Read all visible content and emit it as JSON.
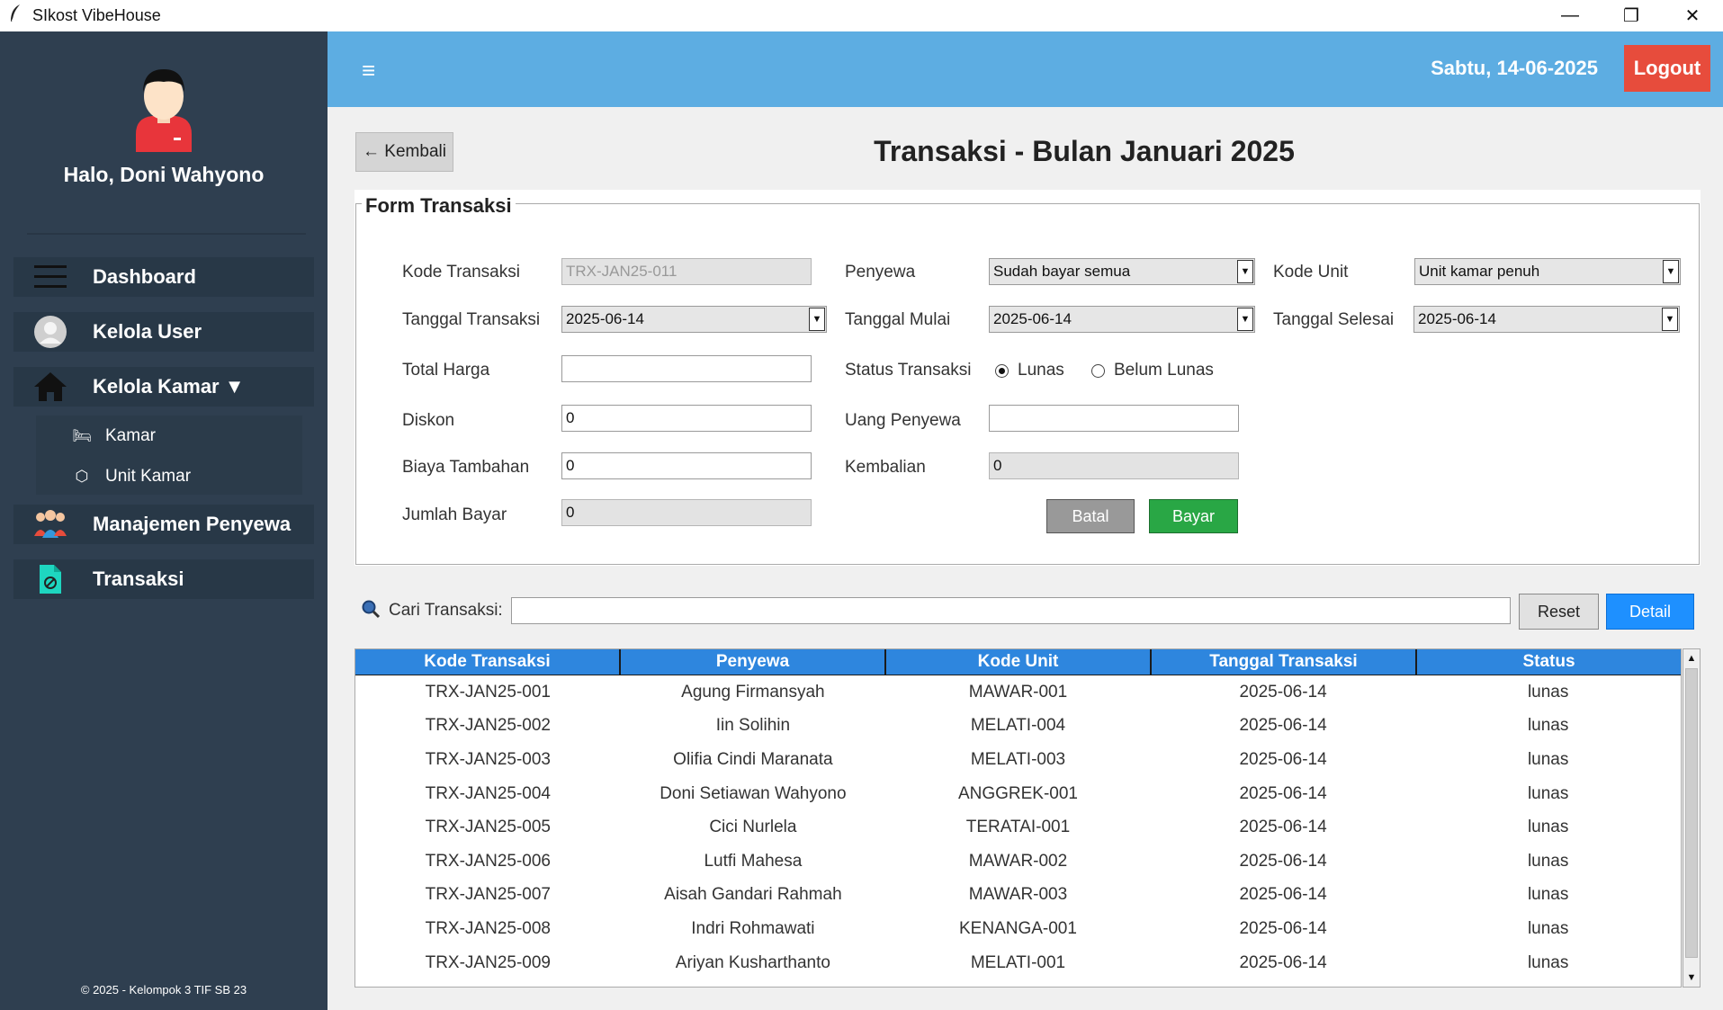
{
  "window": {
    "title": "SIkost VibeHouse",
    "controls": {
      "minimize": "—",
      "restore": "❐",
      "close": "✕"
    }
  },
  "sidebar": {
    "greeting": "Halo, Doni Wahyono",
    "items": [
      {
        "label": "Dashboard",
        "icon": "menu-icon"
      },
      {
        "label": "Kelola User",
        "icon": "user-avatar-icon"
      },
      {
        "label": "Kelola Kamar ▼",
        "icon": "house-icon"
      },
      {
        "label": "Manajemen Penyewa",
        "icon": "people-icon"
      },
      {
        "label": "Transaksi",
        "icon": "document-icon"
      }
    ],
    "subitems": [
      {
        "label": "Kamar",
        "icon": "bed-icon"
      },
      {
        "label": "Unit Kamar",
        "icon": "cube-icon"
      }
    ],
    "copyright": "© 2025 - Kelompok 3 TIF SB 23"
  },
  "header": {
    "menu_glyph": "≡",
    "date": "Sabtu, 14-06-2025",
    "logout_label": "Logout"
  },
  "page": {
    "back_label": "← Kembali",
    "title": "Transaksi - Bulan Januari 2025"
  },
  "form": {
    "legend": "Form Transaksi",
    "kode_transaksi": {
      "label": "Kode Transaksi",
      "value": "TRX-JAN25-011"
    },
    "tanggal_transaksi": {
      "label": "Tanggal Transaksi",
      "value": "2025-06-14"
    },
    "total_harga": {
      "label": "Total Harga",
      "value": ""
    },
    "diskon": {
      "label": "Diskon",
      "value": "0"
    },
    "biaya_tambahan": {
      "label": "Biaya Tambahan",
      "value": "0"
    },
    "jumlah_bayar": {
      "label": "Jumlah Bayar",
      "value": "0"
    },
    "penyewa": {
      "label": "Penyewa",
      "value": "Sudah bayar semua"
    },
    "tanggal_mulai": {
      "label": "Tanggal Mulai",
      "value": "2025-06-14"
    },
    "status_transaksi": {
      "label": "Status Transaksi",
      "options": [
        "Lunas",
        "Belum Lunas"
      ],
      "selected": "Lunas"
    },
    "uang_penyewa": {
      "label": "Uang Penyewa",
      "value": ""
    },
    "kembalian": {
      "label": "Kembalian",
      "value": "0"
    },
    "kode_unit": {
      "label": "Kode Unit",
      "value": "Unit kamar penuh"
    },
    "tanggal_selesai": {
      "label": "Tanggal Selesai",
      "value": "2025-06-14"
    },
    "batal_label": "Batal",
    "bayar_label": "Bayar",
    "dropdown_glyph": "▼"
  },
  "search": {
    "label": "Cari Transaksi:",
    "value": "",
    "reset_label": "Reset",
    "detail_label": "Detail"
  },
  "table": {
    "columns": [
      "Kode Transaksi",
      "Penyewa",
      "Kode Unit",
      "Tanggal Transaksi",
      "Status"
    ],
    "rows": [
      [
        "TRX-JAN25-001",
        "Agung Firmansyah",
        "MAWAR-001",
        "2025-06-14",
        "lunas"
      ],
      [
        "TRX-JAN25-002",
        "Iin Solihin",
        "MELATI-004",
        "2025-06-14",
        "lunas"
      ],
      [
        "TRX-JAN25-003",
        "Olifia Cindi Maranata",
        "MELATI-003",
        "2025-06-14",
        "lunas"
      ],
      [
        "TRX-JAN25-004",
        "Doni Setiawan Wahyono",
        "ANGGREK-001",
        "2025-06-14",
        "lunas"
      ],
      [
        "TRX-JAN25-005",
        "Cici Nurlela",
        "TERATAI-001",
        "2025-06-14",
        "lunas"
      ],
      [
        "TRX-JAN25-006",
        "Lutfi Mahesa",
        "MAWAR-002",
        "2025-06-14",
        "lunas"
      ],
      [
        "TRX-JAN25-007",
        "Aisah Gandari Rahmah",
        "MAWAR-003",
        "2025-06-14",
        "lunas"
      ],
      [
        "TRX-JAN25-008",
        "Indri Rohmawati",
        "KENANGA-001",
        "2025-06-14",
        "lunas"
      ],
      [
        "TRX-JAN25-009",
        "Ariyan Kusharthanto",
        "MELATI-001",
        "2025-06-14",
        "lunas"
      ]
    ]
  },
  "colors": {
    "sidebar_bg": "#2f3f50",
    "header_bg": "#5dade2",
    "logout_bg": "#e74c3c",
    "table_header_bg": "#2e86de",
    "bayar_bg": "#29a745",
    "detail_bg": "#1e90ff"
  }
}
